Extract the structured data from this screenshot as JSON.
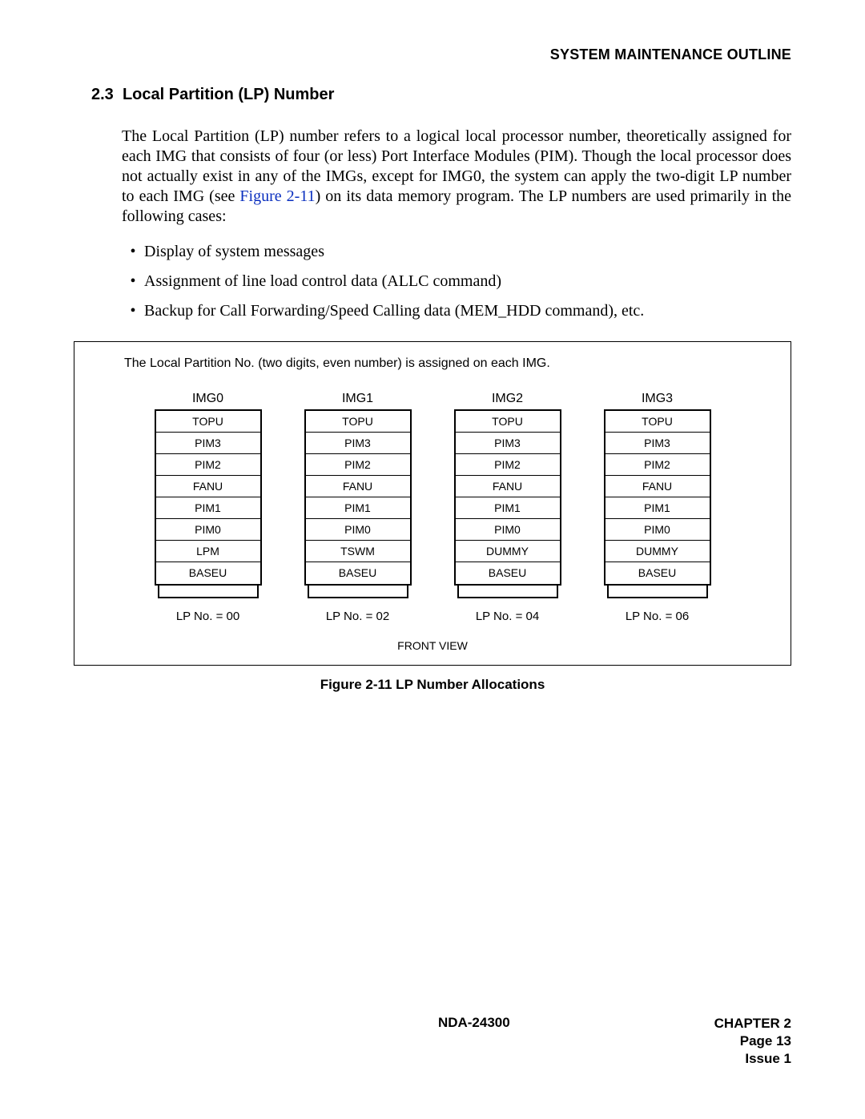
{
  "header": {
    "title": "SYSTEM MAINTENANCE OUTLINE"
  },
  "section": {
    "number": "2.3",
    "title": "Local Partition (LP) Number"
  },
  "paragraph": {
    "pre": "The Local Partition (LP) number refers to a logical local processor number, theoretically assigned for each IMG that consists of four (or less) Port Interface Modules (PIM). Though the local processor does not actually exist in any of the IMGs, except for IMG0, the system can apply the two-digit LP number to each IMG (see ",
    "figref": "Figure 2-11",
    "post": ") on its data memory program. The LP numbers are used primarily in the following cases:"
  },
  "bullets": [
    "Display of system messages",
    "Assignment of line load control data (ALLC command)",
    "Backup for Call Forwarding/Speed Calling data (MEM_HDD command), etc."
  ],
  "figure": {
    "note": "The Local Partition No. (two digits, even number) is assigned on each IMG.",
    "front_view": "FRONT VIEW",
    "caption": "Figure 2-11   LP Number Allocations",
    "columns": [
      {
        "label": "IMG0",
        "cells": [
          "TOPU",
          "PIM3",
          "PIM2",
          "FANU",
          "PIM1",
          "PIM0",
          "LPM",
          "BASEU"
        ],
        "lp": "LP No. = 00"
      },
      {
        "label": "IMG1",
        "cells": [
          "TOPU",
          "PIM3",
          "PIM2",
          "FANU",
          "PIM1",
          "PIM0",
          "TSWM",
          "BASEU"
        ],
        "lp": "LP No. = 02"
      },
      {
        "label": "IMG2",
        "cells": [
          "TOPU",
          "PIM3",
          "PIM2",
          "FANU",
          "PIM1",
          "PIM0",
          "DUMMY",
          "BASEU"
        ],
        "lp": "LP No. = 04"
      },
      {
        "label": "IMG3",
        "cells": [
          "TOPU",
          "PIM3",
          "PIM2",
          "FANU",
          "PIM1",
          "PIM0",
          "DUMMY",
          "BASEU"
        ],
        "lp": "LP No. = 06"
      }
    ]
  },
  "footer": {
    "center": "NDA-24300",
    "right": [
      "CHAPTER 2",
      "Page 13",
      "Issue 1"
    ]
  }
}
